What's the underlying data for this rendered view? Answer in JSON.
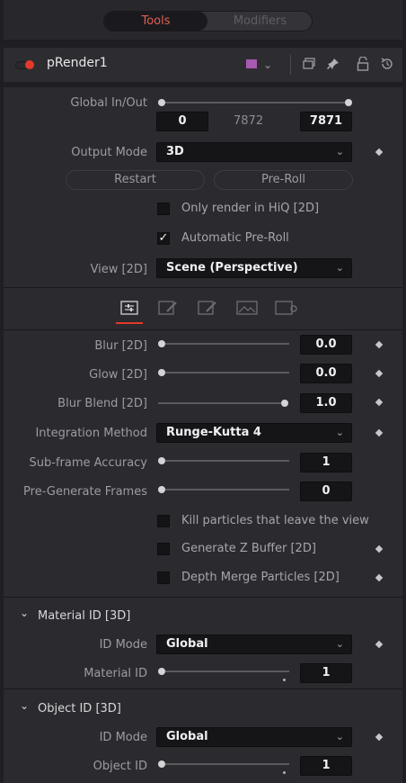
{
  "tabs": {
    "tools": "Tools",
    "modifiers": "Modifiers"
  },
  "header": {
    "tool_name": "pRender1"
  },
  "global": {
    "label": "Global In/Out",
    "in": "0",
    "mid": "7872",
    "out": "7871"
  },
  "output_mode": {
    "label": "Output Mode",
    "value": "3D"
  },
  "buttons": {
    "restart": "Restart",
    "preroll": "Pre-Roll"
  },
  "checks": {
    "hiq": "Only render in HiQ [2D]",
    "auto_preroll": "Automatic Pre-Roll"
  },
  "view": {
    "label": "View [2D]",
    "value": "Scene (Perspective)"
  },
  "params": {
    "blur": {
      "label": "Blur [2D]",
      "value": "0.0"
    },
    "glow": {
      "label": "Glow [2D]",
      "value": "0.0"
    },
    "blur_blend": {
      "label": "Blur Blend [2D]",
      "value": "1.0"
    },
    "integration": {
      "label": "Integration Method",
      "value": "Runge-Kutta 4"
    },
    "subframe": {
      "label": "Sub-frame Accuracy",
      "value": "1"
    },
    "pregen": {
      "label": "Pre-Generate Frames",
      "value": "0"
    }
  },
  "checks2": {
    "kill": "Kill particles that leave the view",
    "zbuffer": "Generate Z Buffer [2D]",
    "depth_merge": "Depth Merge Particles [2D]"
  },
  "material_section": {
    "title": "Material ID [3D]",
    "id_mode_label": "ID Mode",
    "id_mode_value": "Global",
    "id_label": "Material ID",
    "id_value": "1"
  },
  "object_section": {
    "title": "Object ID [3D]",
    "id_mode_label": "ID Mode",
    "id_mode_value": "Global",
    "id_label": "Object ID",
    "id_value": "1"
  },
  "icons": {
    "chevron": "⌄",
    "checkmark": "✓",
    "section_arrow": "⌄"
  }
}
